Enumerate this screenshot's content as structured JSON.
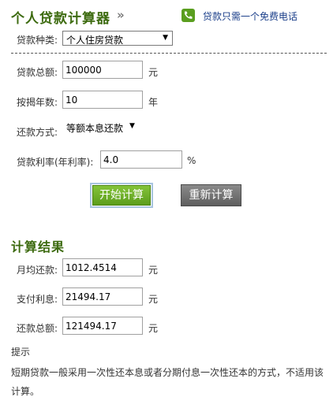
{
  "header": {
    "title": "个人贷款计算器",
    "chevrons": "»",
    "phone_link": "贷款只需一个免费电话"
  },
  "form": {
    "loan_type_label": "贷款种类:",
    "loan_type_value": "个人住房贷款",
    "amount_label": "贷款总额:",
    "amount_value": "100000",
    "amount_unit": "元",
    "years_label": "按揭年数:",
    "years_value": "10",
    "years_unit": "年",
    "method_label": "还款方式:",
    "method_value": "等额本息还款",
    "rate_label": "贷款利率(年利率):",
    "rate_value": "4.0",
    "rate_unit": "%"
  },
  "buttons": {
    "start": "开始计算",
    "reset": "重新计算"
  },
  "results": {
    "title": "计算结果",
    "monthly_label": "月均还款:",
    "monthly_value": "1012.4514",
    "monthly_unit": "元",
    "interest_label": "支付利息:",
    "interest_value": "21494.17",
    "interest_unit": "元",
    "total_label": "还款总额:",
    "total_value": "121494.17",
    "total_unit": "元"
  },
  "tip": {
    "title": "提示",
    "text": "短期贷款一般采用一次性还本息或者分期付息一次性还本的方式，不适用该计算。"
  },
  "colors": {
    "title_green": "#3d6b10",
    "button_green": "#6aab27",
    "button_gray": "#707070",
    "link_blue": "#1b3f8a"
  },
  "icons": {
    "header_arrows": "double-chevron-right-icon",
    "phone": "phone-icon",
    "dropdown": "caret-down-icon"
  }
}
